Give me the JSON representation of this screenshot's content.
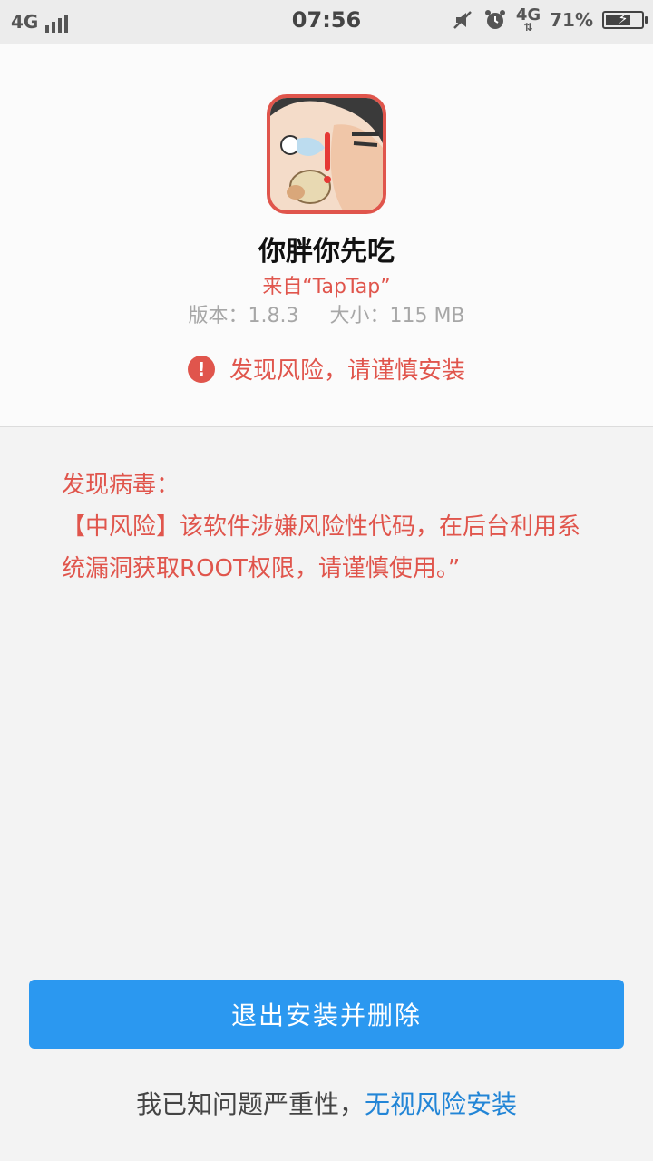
{
  "status_bar": {
    "network_left": "4G",
    "time": "07:56",
    "network_right": "4G",
    "battery_percent_text": "71%",
    "battery_level": 0.71,
    "icons": [
      "signal-icon",
      "mute-icon",
      "alarm-icon",
      "data-arrows-icon",
      "battery-icon"
    ]
  },
  "app": {
    "name": "你胖你先吃",
    "source": "来自“TapTap”",
    "version_label": "版本：",
    "version": "1.8.3",
    "size_label": "大小：",
    "size": "115 MB",
    "risk_notice": "发现风险，请谨慎安装",
    "icon": "app-icon"
  },
  "virus": {
    "title": "发现病毒：",
    "description": "【中风险】该软件涉嫌风险性代码，在后台利用系统漏洞获取ROOT权限，请谨慎使用。”"
  },
  "actions": {
    "exit_button_label": "退出安装并删除",
    "ignore_prefix": "我已知问题严重性，",
    "ignore_link_label": "无视风险安装"
  },
  "colors": {
    "accent_blue": "#2b98f0",
    "link_blue": "#2285d6",
    "risk_red": "#e0554c",
    "background": "#f3f3f3"
  }
}
